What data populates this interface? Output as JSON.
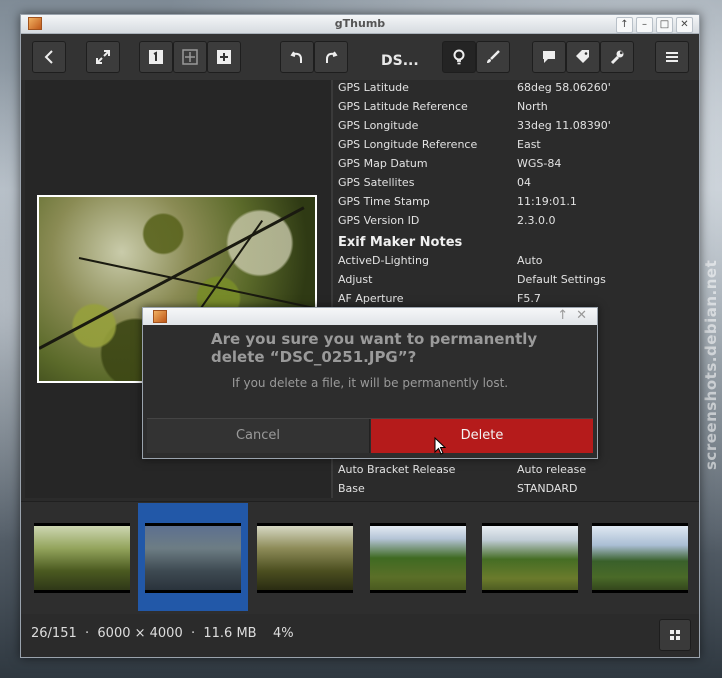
{
  "window": {
    "title": "gThumb"
  },
  "toolbar": {
    "document_title": "DS..."
  },
  "properties": {
    "rows_top": [
      {
        "key": "GPS Latitude",
        "value": "68deg 58.06260'"
      },
      {
        "key": "GPS Latitude Reference",
        "value": "North"
      },
      {
        "key": "GPS Longitude",
        "value": "33deg 11.08390'"
      },
      {
        "key": "GPS Longitude Reference",
        "value": "East"
      },
      {
        "key": "GPS Map Datum",
        "value": "WGS-84"
      },
      {
        "key": "GPS Satellites",
        "value": "04"
      },
      {
        "key": "GPS Time Stamp",
        "value": "11:19:01.1"
      },
      {
        "key": "GPS Version ID",
        "value": "2.3.0.0"
      }
    ],
    "section_heading": "Exif Maker Notes",
    "rows_maker": [
      {
        "key": "ActiveD-Lighting",
        "value": "Auto"
      },
      {
        "key": "Adjust",
        "value": "Default Settings"
      },
      {
        "key": "AF Aperture",
        "value": "F5.7"
      }
    ],
    "rows_bottom": [
      {
        "key": "Auto Bracket Release",
        "value": "Auto release"
      },
      {
        "key": "Base",
        "value": "STANDARD"
      }
    ]
  },
  "thumbnails": {
    "selected_index": 1
  },
  "statusbar": {
    "info": "26/151  ·  6000 × 4000  ·  11.6 MB",
    "zoom": "4%"
  },
  "dialog": {
    "primary": "Are you sure you want to permanently delete “DSC_0251.JPG”?",
    "secondary": "If you delete a file, it will be permanently lost.",
    "cancel_label": "Cancel",
    "delete_label": "Delete",
    "delete_color": "#b51b1b"
  },
  "watermark": "screenshots.debian.net"
}
